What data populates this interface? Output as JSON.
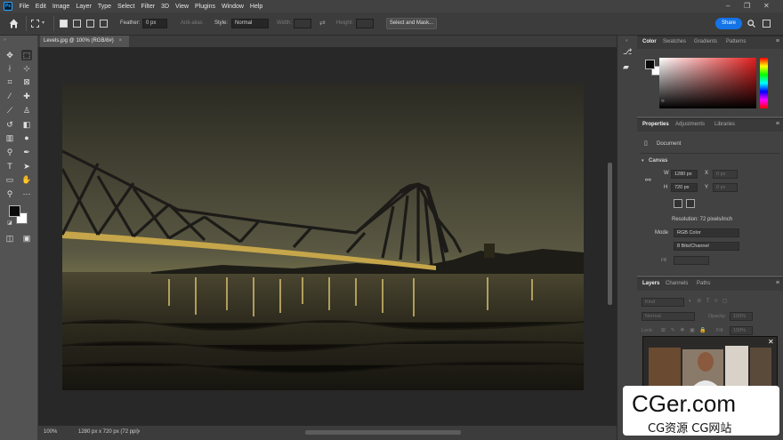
{
  "menubar": {
    "items": [
      "File",
      "Edit",
      "Image",
      "Layer",
      "Type",
      "Select",
      "Filter",
      "3D",
      "View",
      "Plugins",
      "Window",
      "Help"
    ]
  },
  "options_bar": {
    "feather_label": "Feather:",
    "feather_value": "0 px",
    "antialias_label": "Anti-alias",
    "style_label": "Style:",
    "style_value": "Normal",
    "width_label": "Width:",
    "height_label": "Height:",
    "select_mask_label": "Select and Mask...",
    "share_label": "Share"
  },
  "document": {
    "tab_title": "Levels.jpg @ 100% (RGB/8#)",
    "zoom": "100%",
    "status_info": "1280 px x 720 px (72 ppi)"
  },
  "color_panel": {
    "tabs": [
      "Color",
      "Swatches",
      "Gradients",
      "Patterns"
    ],
    "accent": "#e31d1d"
  },
  "properties_panel": {
    "tabs": [
      "Properties",
      "Adjustments",
      "Libraries"
    ],
    "document_label": "Document",
    "canvas_label": "Canvas",
    "w_label": "W",
    "w_value": "1280 px",
    "h_label": "H",
    "h_value": "720 px",
    "x_label": "X",
    "x_value": "0 px",
    "y_label": "Y",
    "y_value": "0 px",
    "resolution": "Resolution: 72 pixels/inch",
    "mode_label": "Mode",
    "mode_value": "RGB Color",
    "bits_value": "8 Bits/Channel",
    "fill_label": "Fill"
  },
  "layers_panel": {
    "tabs": [
      "Layers",
      "Channels",
      "Paths"
    ],
    "kind_placeholder": "Kind",
    "blend_mode": "Normal",
    "opacity_label": "Opacity:",
    "opacity_value": "100%",
    "lock_label": "Lock:",
    "fill_label": "Fill:",
    "fill_value": "100%"
  },
  "watermark": {
    "main": "CGer.com",
    "sub": "CG资源 CG网站"
  }
}
